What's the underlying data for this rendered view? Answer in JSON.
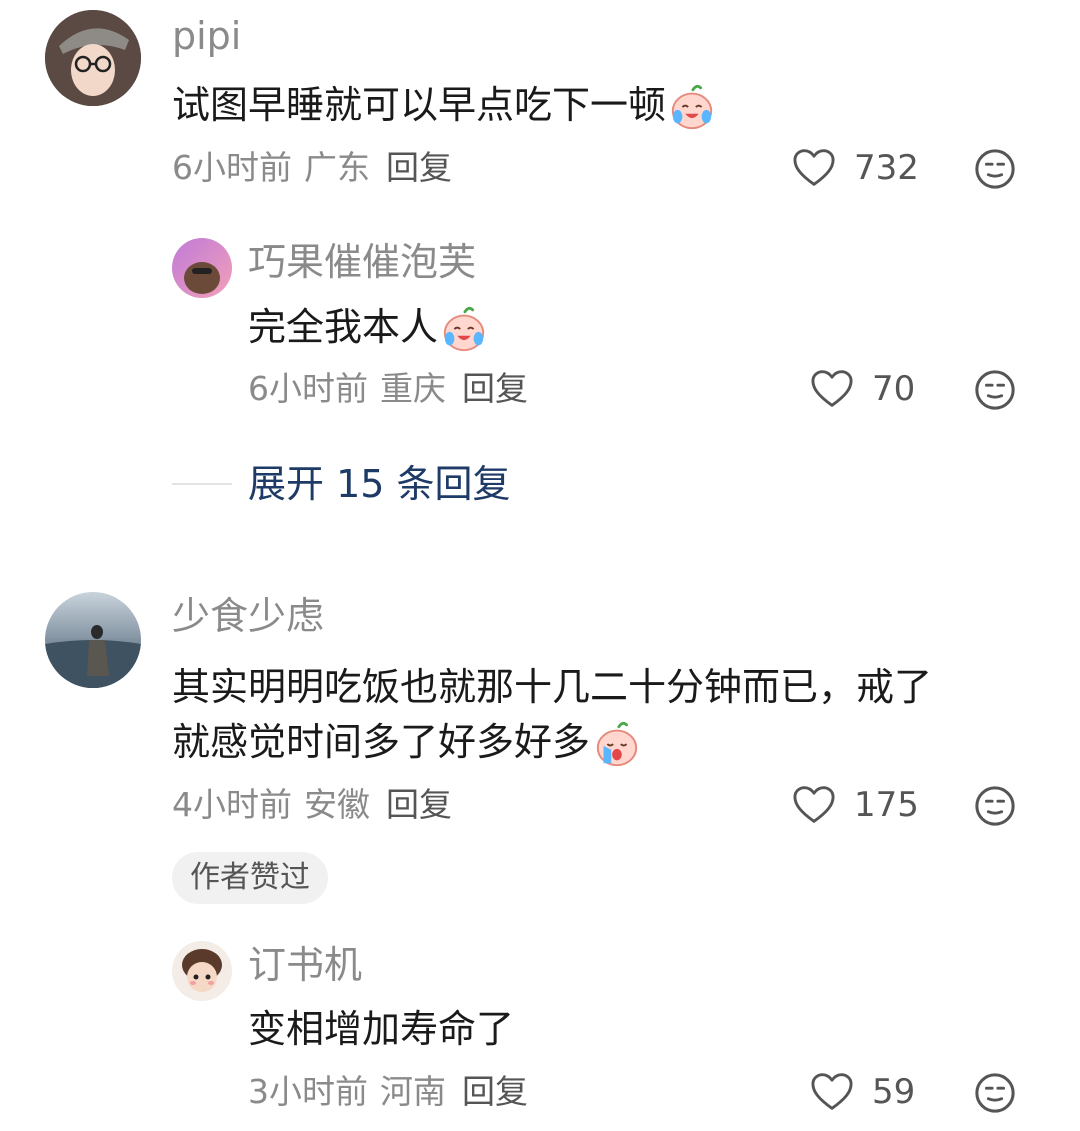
{
  "comments": [
    {
      "user": "pipi",
      "text": "试图早睡就可以早点吃下一顿",
      "emoji": "crying-laugh-emoji",
      "time": "6小时前",
      "location": "广东",
      "reply_label": "回复",
      "likes": "732",
      "replies": [
        {
          "user": "巧果催催泡芙",
          "text": "完全我本人",
          "emoji": "crying-laugh-emoji",
          "time": "6小时前",
          "location": "重庆",
          "reply_label": "回复",
          "likes": "70"
        }
      ],
      "expand_label": "展开 15 条回复"
    },
    {
      "user": "少食少虑",
      "text_line1": "其实明明吃饭也就那十几二十分钟而已，戒了",
      "text_line2": "就感觉时间多了好多好多",
      "emoji": "sobbing-emoji",
      "time": "4小时前",
      "location": "安徽",
      "reply_label": "回复",
      "likes": "175",
      "badge": "作者赞过",
      "replies": [
        {
          "user": "订书机",
          "text": "变相增加寿命了",
          "time": "3小时前",
          "location": "河南",
          "reply_label": "回复",
          "likes": "59"
        }
      ]
    }
  ],
  "colors": {
    "secondary_text": "#8a8a8a",
    "primary_text": "#1a1a1a",
    "expand_link": "#1e3a66"
  }
}
